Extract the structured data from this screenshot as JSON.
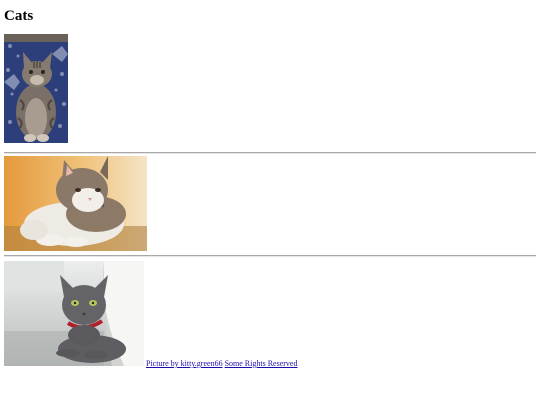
{
  "page": {
    "title": "Cats"
  },
  "photos": [
    {
      "subject": "tabby cat sitting and looking up, on a blue patterned rug"
    },
    {
      "subject": "white and tabby cat lying down, warm orange background"
    },
    {
      "subject": "gray cat with red collar lying on pavement"
    }
  ],
  "credit": {
    "picture_link": "Picture by kitty.green66",
    "license_link": "Some Rights Reserved"
  },
  "colors": {
    "link": "#1a0dab",
    "separator": "#a8a8a8"
  }
}
